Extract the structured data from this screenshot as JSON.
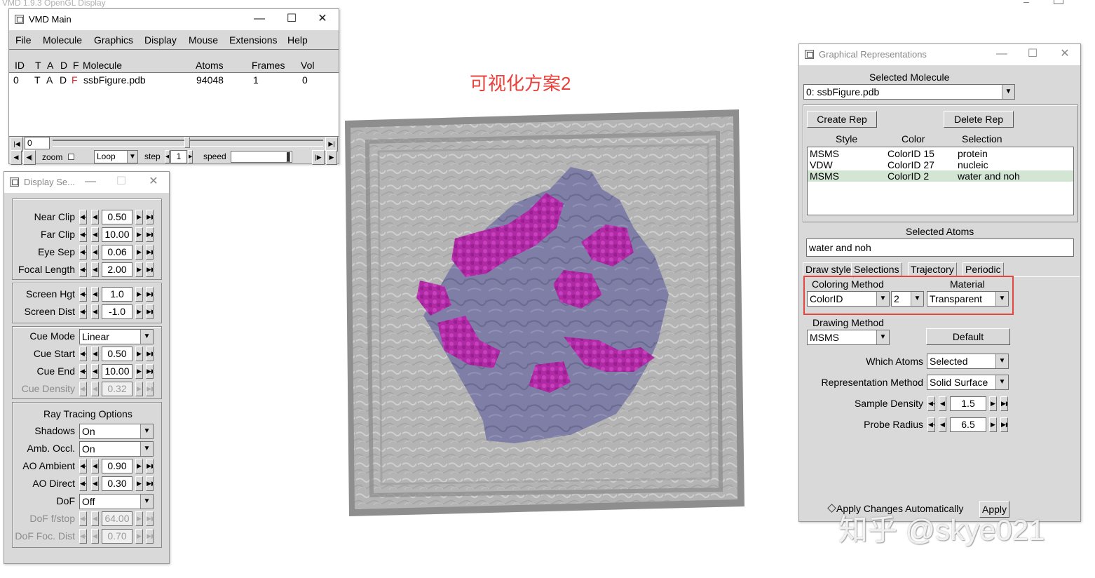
{
  "desktop": {
    "display_title": "VMD 1.9.3 OpenGL Display",
    "annotation": "可视化方案2",
    "watermark": "知乎 @skye021"
  },
  "vmd_main": {
    "title": "VMD Main",
    "menu": [
      "File",
      "Molecule",
      "Graphics",
      "Display",
      "Mouse",
      "Extensions",
      "Help"
    ],
    "columns": {
      "id": "ID",
      "t": "T",
      "a": "A",
      "d": "D",
      "f": "F",
      "molecule": "Molecule",
      "atoms": "Atoms",
      "frames": "Frames",
      "vol": "Vol"
    },
    "row": {
      "id": "0",
      "t": "T",
      "a": "A",
      "d": "D",
      "f": "F",
      "molecule": "ssbFigure.pdb",
      "atoms": "94048",
      "frames": "1",
      "vol": "0"
    },
    "frame_value": "0",
    "zoom_label": "zoom",
    "loop_value": "Loop",
    "step_label": "step",
    "step_value": "1",
    "speed_label": "speed"
  },
  "display_settings": {
    "title": "Display Se...",
    "near_clip": {
      "label": "Near Clip",
      "value": "0.50"
    },
    "far_clip": {
      "label": "Far Clip",
      "value": "10.00"
    },
    "eye_sep": {
      "label": "Eye Sep",
      "value": "0.06"
    },
    "focal_length": {
      "label": "Focal Length",
      "value": "2.00"
    },
    "screen_hgt": {
      "label": "Screen Hgt",
      "value": "1.0"
    },
    "screen_dist": {
      "label": "Screen Dist",
      "value": "-1.0"
    },
    "cue_mode": {
      "label": "Cue Mode",
      "value": "Linear"
    },
    "cue_start": {
      "label": "Cue Start",
      "value": "0.50"
    },
    "cue_end": {
      "label": "Cue End",
      "value": "10.00"
    },
    "cue_density": {
      "label": "Cue Density",
      "value": "0.32"
    },
    "ray_tracing_heading": "Ray Tracing Options",
    "shadows": {
      "label": "Shadows",
      "value": "On"
    },
    "amb_occl": {
      "label": "Amb. Occl.",
      "value": "On"
    },
    "ao_ambient": {
      "label": "AO Ambient",
      "value": "0.90"
    },
    "ao_direct": {
      "label": "AO Direct",
      "value": "0.30"
    },
    "dof": {
      "label": "DoF",
      "value": "Off"
    },
    "dof_fstop": {
      "label": "DoF f/stop",
      "value": "64.00"
    },
    "dof_foc_dist": {
      "label": "DoF Foc. Dist",
      "value": "0.70"
    }
  },
  "graphical_reps": {
    "title": "Graphical Representations",
    "selected_molecule_label": "Selected Molecule",
    "selected_molecule_value": "0: ssbFigure.pdb",
    "create_rep": "Create Rep",
    "delete_rep": "Delete Rep",
    "columns": {
      "style": "Style",
      "color": "Color",
      "selection": "Selection"
    },
    "reps": [
      {
        "style": "MSMS",
        "color": "ColorID 15",
        "selection": "protein"
      },
      {
        "style": "VDW",
        "color": "ColorID 27",
        "selection": "nucleic"
      },
      {
        "style": "MSMS",
        "color": "ColorID 2",
        "selection": "water and noh"
      }
    ],
    "selected_atoms_label": "Selected Atoms",
    "selected_atoms_value": "water and noh",
    "tabs": [
      "Draw style",
      "Selections",
      "Trajectory",
      "Periodic"
    ],
    "coloring_method_label": "Coloring Method",
    "coloring_method_value": "ColorID",
    "color_id_value": "2",
    "material_label": "Material",
    "material_value": "Transparent",
    "drawing_method_label": "Drawing Method",
    "drawing_method_value": "MSMS",
    "default_button": "Default",
    "which_atoms_label": "Which Atoms",
    "which_atoms_value": "Selected",
    "rep_method_label": "Representation Method",
    "rep_method_value": "Solid Surface",
    "sample_density_label": "Sample Density",
    "sample_density_value": "1.5",
    "probe_radius_label": "Probe Radius",
    "probe_radius_value": "6.5",
    "apply_auto_label": "Apply Changes Automatically",
    "apply_button": "Apply"
  },
  "colors": {
    "annotation_red": "#e8403a",
    "highlight_box": "#e2463f",
    "selected_row": "#d3e6d3",
    "protein": "#7f7ea6",
    "nucleic": "#b02aa6",
    "water_box": "#9a9a9a"
  }
}
